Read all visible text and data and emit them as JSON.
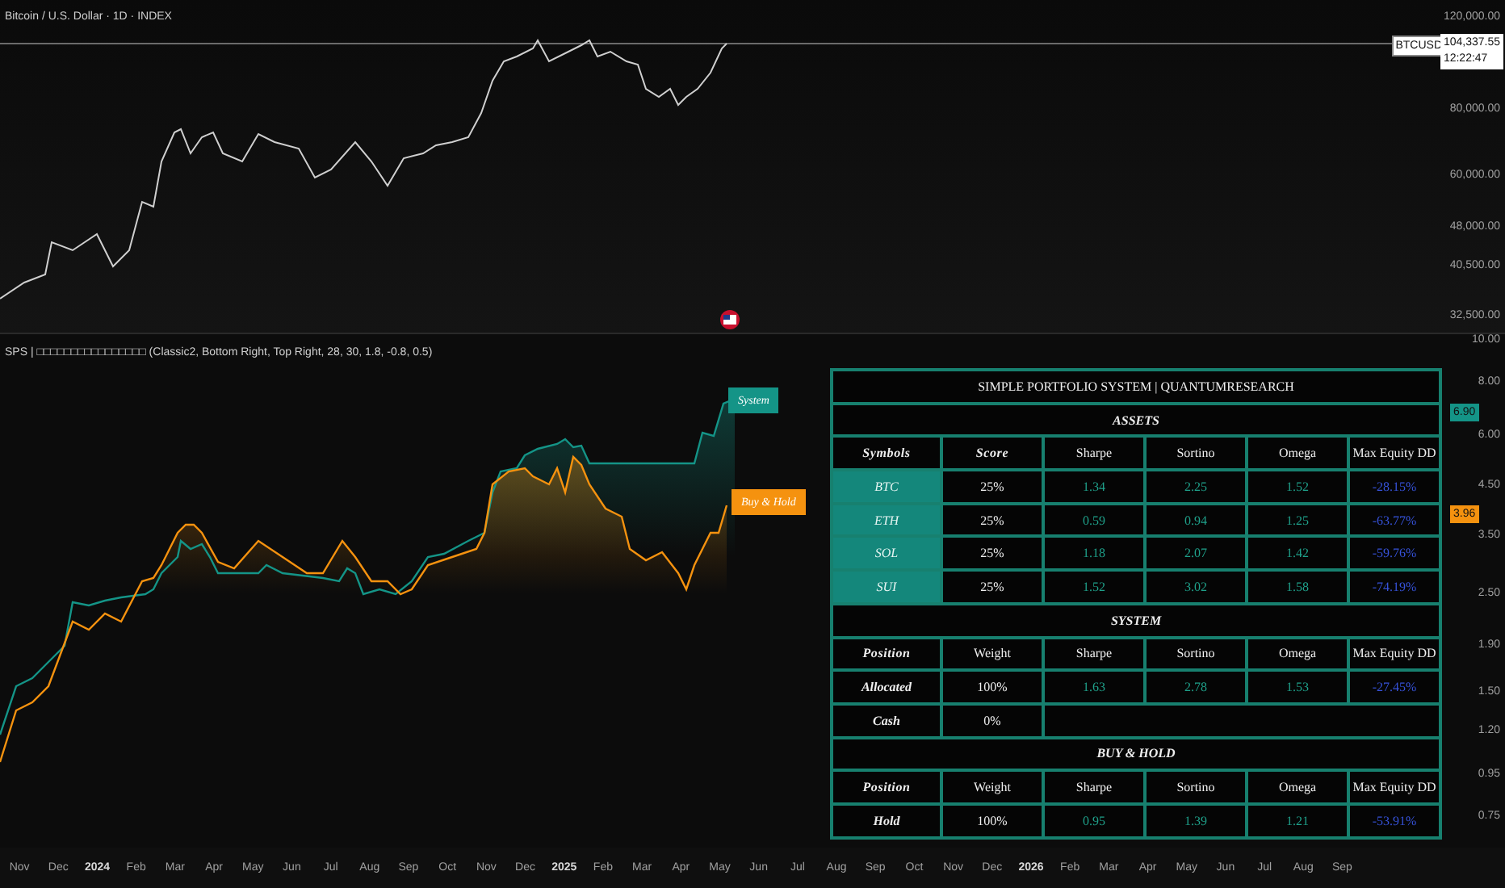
{
  "main_chart": {
    "title": "Bitcoin / U.S. Dollar · 1D · INDEX",
    "price_axis": [
      "120,000.00",
      "80,000.00",
      "60,000.00",
      "48,000.00",
      "40,500.00",
      "32,500.00"
    ],
    "symbol_tag": "BTCUSD",
    "price_tag": "104,337.55",
    "countdown": "12:22:47"
  },
  "indicator": {
    "title": "SPS | □□□□□□□□□□□□□□□□ (Classic2, Bottom Right, Top Right, 28, 30, 1.8, -0.8, 0.5)",
    "axis": [
      "10.00",
      "8.00",
      "6.00",
      "4.50",
      "3.50",
      "2.50",
      "1.90",
      "1.50",
      "1.20",
      "0.95",
      "0.75"
    ],
    "series": [
      {
        "label": "System",
        "color": "#149487",
        "last_value": "6.90"
      },
      {
        "label": "Buy & Hold",
        "color": "#f5920f",
        "last_value": "3.96"
      }
    ],
    "table": {
      "title": "SIMPLE PORTFOLIO SYSTEM | QUANTUMRESEARCH",
      "sections": [
        {
          "heading": "ASSETS",
          "columns": [
            {
              "label": "Symbols",
              "kind": "symbol",
              "script": true
            },
            {
              "label": "Score",
              "kind": "weight",
              "script": true
            },
            {
              "label": "Sharpe",
              "kind": "metric",
              "script": false
            },
            {
              "label": "Sortino",
              "kind": "metric",
              "script": false
            },
            {
              "label": "Omega",
              "kind": "metric",
              "script": false
            },
            {
              "label": "Max Equity DD",
              "kind": "drawdown",
              "script": false
            }
          ],
          "rows": [
            [
              "BTC",
              "25%",
              "1.34",
              "2.25",
              "1.52",
              "-28.15%"
            ],
            [
              "ETH",
              "25%",
              "0.59",
              "0.94",
              "1.25",
              "-63.77%"
            ],
            [
              "SOL",
              "25%",
              "1.18",
              "2.07",
              "1.42",
              "-59.76%"
            ],
            [
              "SUI",
              "25%",
              "1.52",
              "3.02",
              "1.58",
              "-74.19%"
            ]
          ]
        },
        {
          "heading": "SYSTEM",
          "columns": [
            {
              "label": "Position",
              "kind": "position",
              "script": true
            },
            {
              "label": "Weight",
              "kind": "weight",
              "script": false
            },
            {
              "label": "Sharpe",
              "kind": "metric",
              "script": false
            },
            {
              "label": "Sortino",
              "kind": "metric",
              "script": false
            },
            {
              "label": "Omega",
              "kind": "metric",
              "script": false
            },
            {
              "label": "Max Equity DD",
              "kind": "drawdown",
              "script": false
            }
          ],
          "rows": [
            [
              "Allocated",
              "100%",
              "1.63",
              "2.78",
              "1.53",
              "-27.45%"
            ],
            [
              "Cash",
              "0%"
            ]
          ]
        },
        {
          "heading": "BUY & HOLD",
          "columns": [
            {
              "label": "Position",
              "kind": "position",
              "script": true
            },
            {
              "label": "Weight",
              "kind": "weight",
              "script": false
            },
            {
              "label": "Sharpe",
              "kind": "metric",
              "script": false
            },
            {
              "label": "Sortino",
              "kind": "metric",
              "script": false
            },
            {
              "label": "Omega",
              "kind": "metric",
              "script": false
            },
            {
              "label": "Max Equity DD",
              "kind": "drawdown",
              "script": false
            }
          ],
          "rows": [
            [
              "Hold",
              "100%",
              "0.95",
              "1.39",
              "1.21",
              "-53.91%"
            ]
          ]
        }
      ]
    }
  },
  "time_axis": [
    {
      "label": "Nov",
      "kind": "month"
    },
    {
      "label": "Dec",
      "kind": "month"
    },
    {
      "label": "2024",
      "kind": "year"
    },
    {
      "label": "Feb",
      "kind": "month"
    },
    {
      "label": "Mar",
      "kind": "month"
    },
    {
      "label": "Apr",
      "kind": "month"
    },
    {
      "label": "May",
      "kind": "month"
    },
    {
      "label": "Jun",
      "kind": "month"
    },
    {
      "label": "Jul",
      "kind": "month"
    },
    {
      "label": "Aug",
      "kind": "month"
    },
    {
      "label": "Sep",
      "kind": "month"
    },
    {
      "label": "Oct",
      "kind": "month"
    },
    {
      "label": "Nov",
      "kind": "month"
    },
    {
      "label": "Dec",
      "kind": "month"
    },
    {
      "label": "2025",
      "kind": "year"
    },
    {
      "label": "Feb",
      "kind": "month"
    },
    {
      "label": "Mar",
      "kind": "month"
    },
    {
      "label": "Apr",
      "kind": "month"
    },
    {
      "label": "May",
      "kind": "month"
    },
    {
      "label": "Jun",
      "kind": "month"
    },
    {
      "label": "Jul",
      "kind": "month"
    },
    {
      "label": "Aug",
      "kind": "month"
    },
    {
      "label": "Sep",
      "kind": "month"
    },
    {
      "label": "Oct",
      "kind": "month"
    },
    {
      "label": "Nov",
      "kind": "month"
    },
    {
      "label": "Dec",
      "kind": "month"
    },
    {
      "label": "2026",
      "kind": "year"
    },
    {
      "label": "Feb",
      "kind": "month"
    },
    {
      "label": "Mar",
      "kind": "month"
    },
    {
      "label": "Apr",
      "kind": "month"
    },
    {
      "label": "May",
      "kind": "month"
    },
    {
      "label": "Jun",
      "kind": "month"
    },
    {
      "label": "Jul",
      "kind": "month"
    },
    {
      "label": "Aug",
      "kind": "month"
    },
    {
      "label": "Sep",
      "kind": "month"
    }
  ]
}
